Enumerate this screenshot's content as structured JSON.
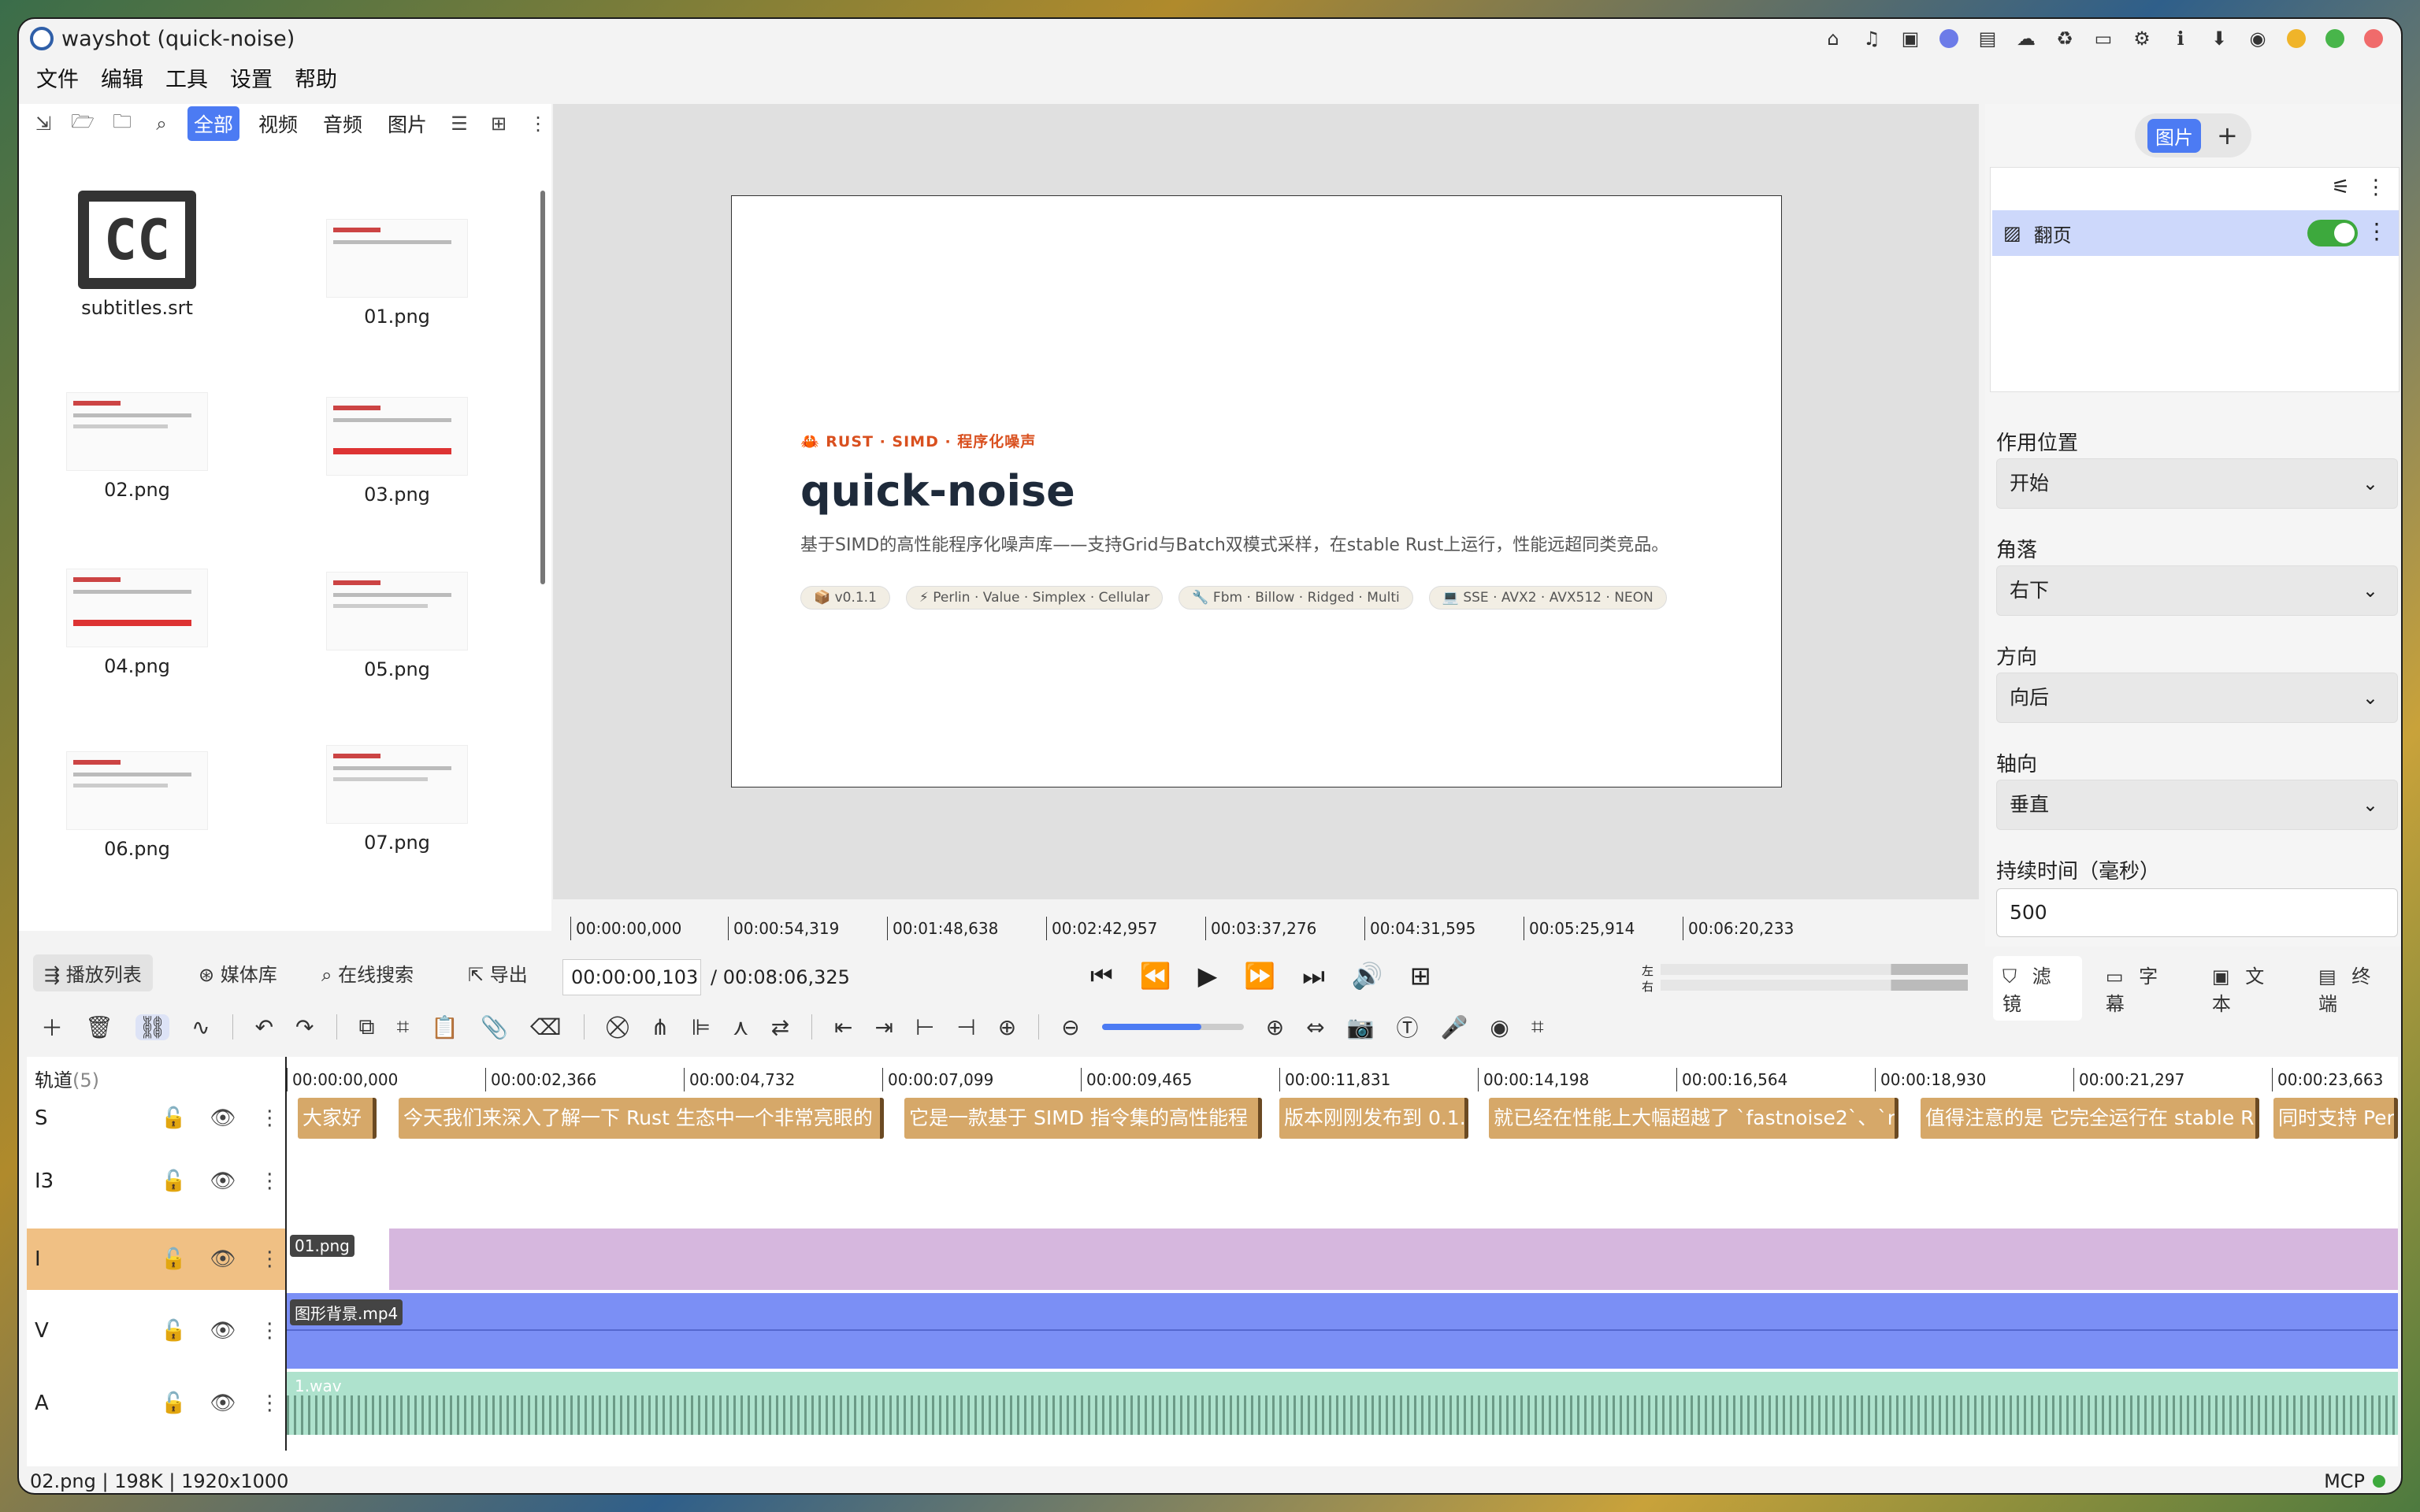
{
  "window": {
    "title": "wayshot (quick-noise)"
  },
  "menu": [
    "文件",
    "编辑",
    "工具",
    "设置",
    "帮助"
  ],
  "left": {
    "tabs": [
      "全部",
      "视频",
      "音频",
      "图片"
    ],
    "files": [
      {
        "name": "subtitles.srt"
      },
      {
        "name": "01.png"
      },
      {
        "name": "02.png"
      },
      {
        "name": "03.png"
      },
      {
        "name": "04.png"
      },
      {
        "name": "05.png"
      },
      {
        "name": "06.png"
      },
      {
        "name": "07.png"
      }
    ]
  },
  "preview": {
    "tag": "🦀 RUST · SIMD · 程序化噪声",
    "title": "quick-noise",
    "desc": "基于SIMD的高性能程序化噪声库——支持Grid与Batch双模式采样，在stable Rust上运行，性能远超同类竞品。",
    "chips": [
      "📦 v0.1.1",
      "⚡ Perlin · Value · Simplex · Cellular",
      "🔧 Fbm · Billow · Ridged · Multi",
      "💻 SSE · AVX2 · AVX512 · NEON"
    ],
    "ruler": [
      "00:00:00,000",
      "00:00:54,319",
      "00:01:48,638",
      "00:02:42,957",
      "00:03:37,276",
      "00:04:31,595",
      "00:05:25,914",
      "00:06:20,233"
    ]
  },
  "right": {
    "segment": "图片",
    "filter_name": "翻页",
    "props": [
      {
        "label": "作用位置",
        "value": "开始"
      },
      {
        "label": "角落",
        "value": "右下"
      },
      {
        "label": "方向",
        "value": "向后"
      },
      {
        "label": "轴向",
        "value": "垂直"
      }
    ],
    "duration_label": "持续时间（毫秒）",
    "duration_value": "500"
  },
  "bottom_tabs": [
    "播放列表",
    "媒体库",
    "在线搜索",
    "导出"
  ],
  "transport": {
    "current": "00:00:00,103",
    "total": "/  00:08:06,325"
  },
  "vu_labels": [
    "左",
    "右"
  ],
  "right_tabs": [
    "滤镜",
    "字幕",
    "文本",
    "终端"
  ],
  "timeline": {
    "header": "轨道",
    "count": "(5)",
    "ruler": [
      "00:00:00,000",
      "00:00:02,366",
      "00:00:04,732",
      "00:00:07,099",
      "00:00:09,465",
      "00:00:11,831",
      "00:00:14,198",
      "00:00:16,564",
      "00:00:18,930",
      "00:00:21,297",
      "00:00:23,663"
    ],
    "tracks": [
      "S",
      "I3",
      "I",
      "V",
      "A"
    ],
    "subtitles": [
      "大家好",
      "今天我们来深入了解一下 Rust 生态中一个非常亮眼的",
      "它是一款基于 SIMD 指令集的高性能程",
      "版本刚刚发布到 0.1.",
      "就已经在性能上大幅超越了 `fastnoise2`、`r",
      "值得注意的是 它完全运行在 stable R",
      "同时支持 Perlin"
    ],
    "img_clip": "01.png",
    "video_clip": "图形背景.mp4",
    "audio_clip": "1.wav"
  },
  "status": {
    "left": "02.png | 198K | 1920x1000",
    "right": "MCP"
  }
}
